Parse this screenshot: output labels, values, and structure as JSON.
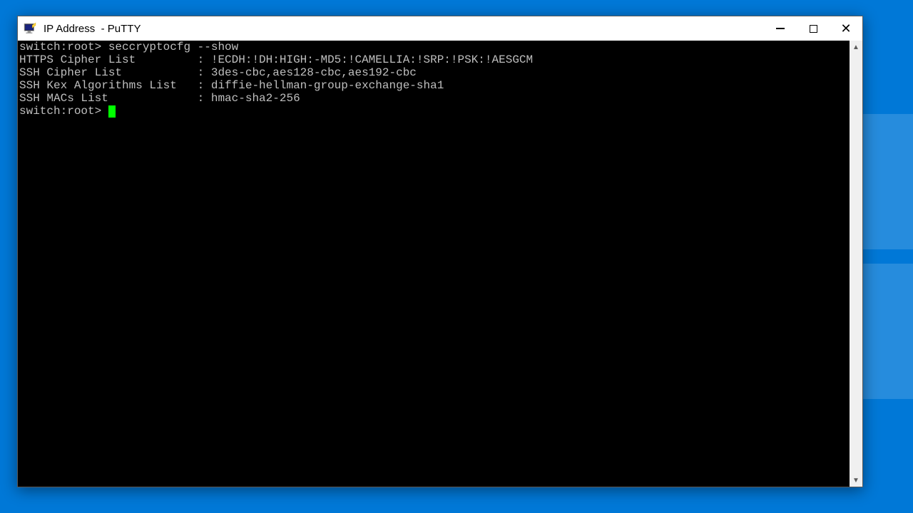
{
  "window": {
    "title": "IP Address  - PuTTY"
  },
  "terminal": {
    "prompt": "switch:root>",
    "command": "seccryptocfg --show",
    "output": [
      {
        "label": "HTTPS Cipher List",
        "value": "!ECDH:!DH:HIGH:-MD5:!CAMELLIA:!SRP:!PSK:!AESGCM"
      },
      {
        "label": "SSH Cipher List",
        "value": "3des-cbc,aes128-cbc,aes192-cbc"
      },
      {
        "label": "SSH Kex Algorithms List",
        "value": "diffie-hellman-group-exchange-sha1"
      },
      {
        "label": "SSH MACs List",
        "value": "hmac-sha2-256"
      }
    ],
    "label_col_width": 25
  }
}
